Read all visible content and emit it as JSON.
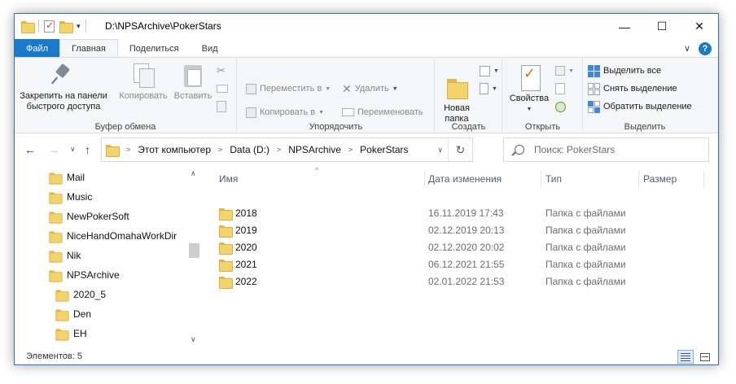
{
  "window": {
    "title": "D:\\NPSArchive\\PokerStars",
    "minimize_glyph": "—",
    "maximize_glyph": "☐",
    "close_glyph": "✕"
  },
  "ribbon_tabs": {
    "file": "Файл",
    "home": "Главная",
    "share": "Поделиться",
    "view": "Вид",
    "collapse_glyph": "∨",
    "help_glyph": "?"
  },
  "clipboard": {
    "pin": "Закрепить на панели быстрого доступа",
    "pin_line1": "Закрепить на панели",
    "pin_line2": "быстрого доступа",
    "copy": "Копировать",
    "paste": "Вставить",
    "label": "Буфер обмена"
  },
  "organize": {
    "move_to": "Переместить в",
    "copy_to": "Копировать в",
    "delete": "Удалить",
    "rename": "Переименовать",
    "label": "Упорядочить"
  },
  "new": {
    "new_folder_line1": "Новая",
    "new_folder_line2": "папка",
    "label": "Создать"
  },
  "open": {
    "properties": "Свойства",
    "label": "Открыть"
  },
  "select": {
    "select_all": "Выделить все",
    "select_none": "Снять выделение",
    "invert": "Обратить выделение",
    "label": "Выделить"
  },
  "address": {
    "crumbs": [
      "Этот компьютер",
      "Data (D:)",
      "NPSArchive",
      "PokerStars"
    ],
    "search_placeholder": "Поиск: PokerStars"
  },
  "nav_tree": [
    {
      "label": "Mail",
      "indent": 0
    },
    {
      "label": "Music",
      "indent": 0
    },
    {
      "label": "NewPokerSoft",
      "indent": 0
    },
    {
      "label": "NiceHandOmahaWorkDir",
      "indent": 0
    },
    {
      "label": "Nik",
      "indent": 0
    },
    {
      "label": "NPSArchive",
      "indent": 0
    },
    {
      "label": "2020_5",
      "indent": 1
    },
    {
      "label": "Den",
      "indent": 1
    },
    {
      "label": "EH",
      "indent": 1
    }
  ],
  "columns": {
    "name": "Имя",
    "date": "Дата изменения",
    "type": "Тип",
    "size": "Размер"
  },
  "files": [
    {
      "name": "2018",
      "date": "16.11.2019 17:43",
      "type": "Папка с файлами"
    },
    {
      "name": "2019",
      "date": "02.12.2019 20:13",
      "type": "Папка с файлами"
    },
    {
      "name": "2020",
      "date": "02.12.2020 20:02",
      "type": "Папка с файлами"
    },
    {
      "name": "2021",
      "date": "06.12.2021 21:55",
      "type": "Папка с файлами"
    },
    {
      "name": "2022",
      "date": "02.01.2022 21:53",
      "type": "Папка с файлами"
    }
  ],
  "status": {
    "count": "Элементов: 5"
  }
}
